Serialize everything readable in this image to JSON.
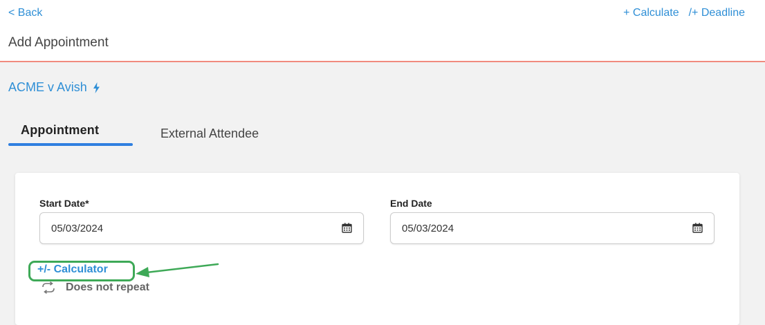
{
  "header": {
    "back_label": "< Back",
    "calculate_label": "+ Calculate",
    "deadline_label": "/+ Deadline",
    "title": "Add Appointment",
    "divider_color": "#f08a7e"
  },
  "matter": {
    "name": "ACME v Avish",
    "icon": "lightning-icon"
  },
  "tabs": [
    {
      "label": "Appointment",
      "active": true
    },
    {
      "label": "External Attendee",
      "active": false
    }
  ],
  "form": {
    "start_date": {
      "label": "Start Date*",
      "value": "05/03/2024",
      "icon": "calendar-icon"
    },
    "end_date": {
      "label": "End Date",
      "value": "05/03/2024",
      "icon": "calendar-icon"
    },
    "calculator_label": "+/- Calculator",
    "repeat_label": "Does not repeat",
    "repeat_icon": "repeat-icon"
  },
  "annotation": {
    "highlight_color": "#3ea957"
  },
  "colors": {
    "link": "#2f8fd6",
    "tab_underline": "#2f7fe0",
    "page_bg": "#f2f2f2"
  }
}
